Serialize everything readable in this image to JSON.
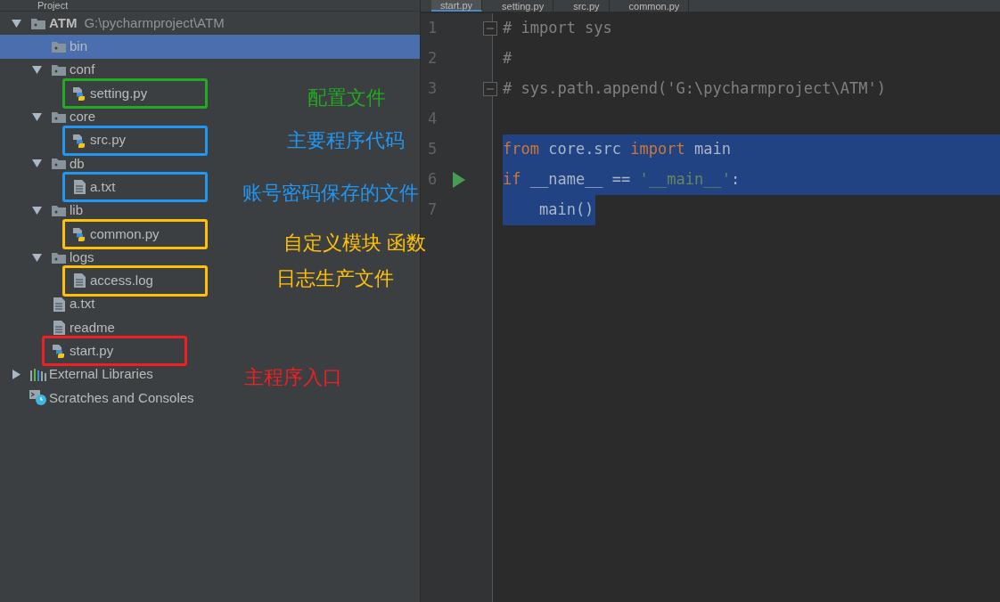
{
  "project_panel": {
    "title": "Project",
    "tree": [
      {
        "name": "ATM",
        "path": "G:\\pycharmproject\\ATM",
        "kind": "root",
        "expanded": true,
        "selected": false,
        "children": [
          {
            "name": "bin",
            "kind": "folder",
            "selected": true
          },
          {
            "name": "conf",
            "kind": "folder",
            "expanded": true,
            "selected": false,
            "children": [
              {
                "name": "setting.py",
                "kind": "python",
                "selected": false,
                "annotation": {
                  "text": "配置文件",
                  "color": "#22aa22"
                }
              }
            ]
          },
          {
            "name": "core",
            "kind": "folder",
            "expanded": true,
            "selected": false,
            "children": [
              {
                "name": "src.py",
                "kind": "python",
                "selected": false,
                "annotation": {
                  "text": "主要程序代码",
                  "color": "#2196f3"
                }
              }
            ]
          },
          {
            "name": "db",
            "kind": "folder",
            "expanded": true,
            "selected": false,
            "children": [
              {
                "name": "a.txt",
                "kind": "text",
                "selected": false,
                "annotation": {
                  "text": "账号密码保存的文件",
                  "color": "#2196f3"
                }
              }
            ]
          },
          {
            "name": "lib",
            "kind": "folder",
            "expanded": true,
            "selected": false,
            "children": [
              {
                "name": "common.py",
                "kind": "python",
                "selected": false,
                "annotation": {
                  "text": "自定义模块 函数",
                  "color": "#ffc107"
                }
              }
            ]
          },
          {
            "name": "logs",
            "kind": "folder",
            "expanded": true,
            "selected": false,
            "children": [
              {
                "name": "access.log",
                "kind": "text",
                "selected": false,
                "annotation": {
                  "text": "日志生产文件",
                  "color": "#ffc107"
                }
              }
            ]
          },
          {
            "name": "a.txt",
            "kind": "text",
            "selected": false
          },
          {
            "name": "readme",
            "kind": "text",
            "selected": false
          },
          {
            "name": "start.py",
            "kind": "python",
            "selected": false,
            "annotation": {
              "text": "主程序入口",
              "color": "#f02020"
            }
          }
        ]
      },
      {
        "name": "External Libraries",
        "kind": "library",
        "expanded": false,
        "selected": false
      },
      {
        "name": "Scratches and Consoles",
        "kind": "scratches",
        "selected": false
      }
    ]
  },
  "editor": {
    "tabs": [
      {
        "label": "start.py",
        "selected": true
      },
      {
        "label": "setting.py",
        "selected": false
      },
      {
        "label": "src.py",
        "selected": false
      },
      {
        "label": "common.py",
        "selected": false
      }
    ],
    "lines": [
      {
        "number": "1",
        "fold": true,
        "run": false,
        "selected": false,
        "tokens": [
          {
            "text": "# import sys",
            "kind": "comment"
          }
        ]
      },
      {
        "number": "2",
        "fold": false,
        "run": false,
        "selected": false,
        "tokens": [
          {
            "text": "#",
            "kind": "comment"
          }
        ]
      },
      {
        "number": "3",
        "fold": true,
        "run": false,
        "selected": false,
        "tokens": [
          {
            "text": "# sys.path.append('G:\\pycharmproject\\ATM')",
            "kind": "comment"
          }
        ]
      },
      {
        "number": "4",
        "fold": false,
        "run": false,
        "selected": false
      },
      {
        "number": "5",
        "fold": false,
        "run": false,
        "selected": true,
        "tokens": [
          {
            "text": "from",
            "kind": "keyword"
          },
          {
            "text": " core.src ",
            "kind": "plain"
          },
          {
            "text": "import",
            "kind": "keyword"
          },
          {
            "text": " main",
            "kind": "plain"
          }
        ]
      },
      {
        "number": "6",
        "fold": false,
        "run": true,
        "selected": true,
        "tokens": [
          {
            "text": "if",
            "kind": "keyword"
          },
          {
            "text": " __name__ == ",
            "kind": "plain"
          },
          {
            "text": "'__main__'",
            "kind": "string"
          },
          {
            "text": ":",
            "kind": "plain"
          }
        ]
      },
      {
        "number": "7",
        "fold": false,
        "run": false,
        "selected": true,
        "tokens": [
          {
            "text": "    main()",
            "kind": "plain"
          }
        ]
      }
    ]
  }
}
